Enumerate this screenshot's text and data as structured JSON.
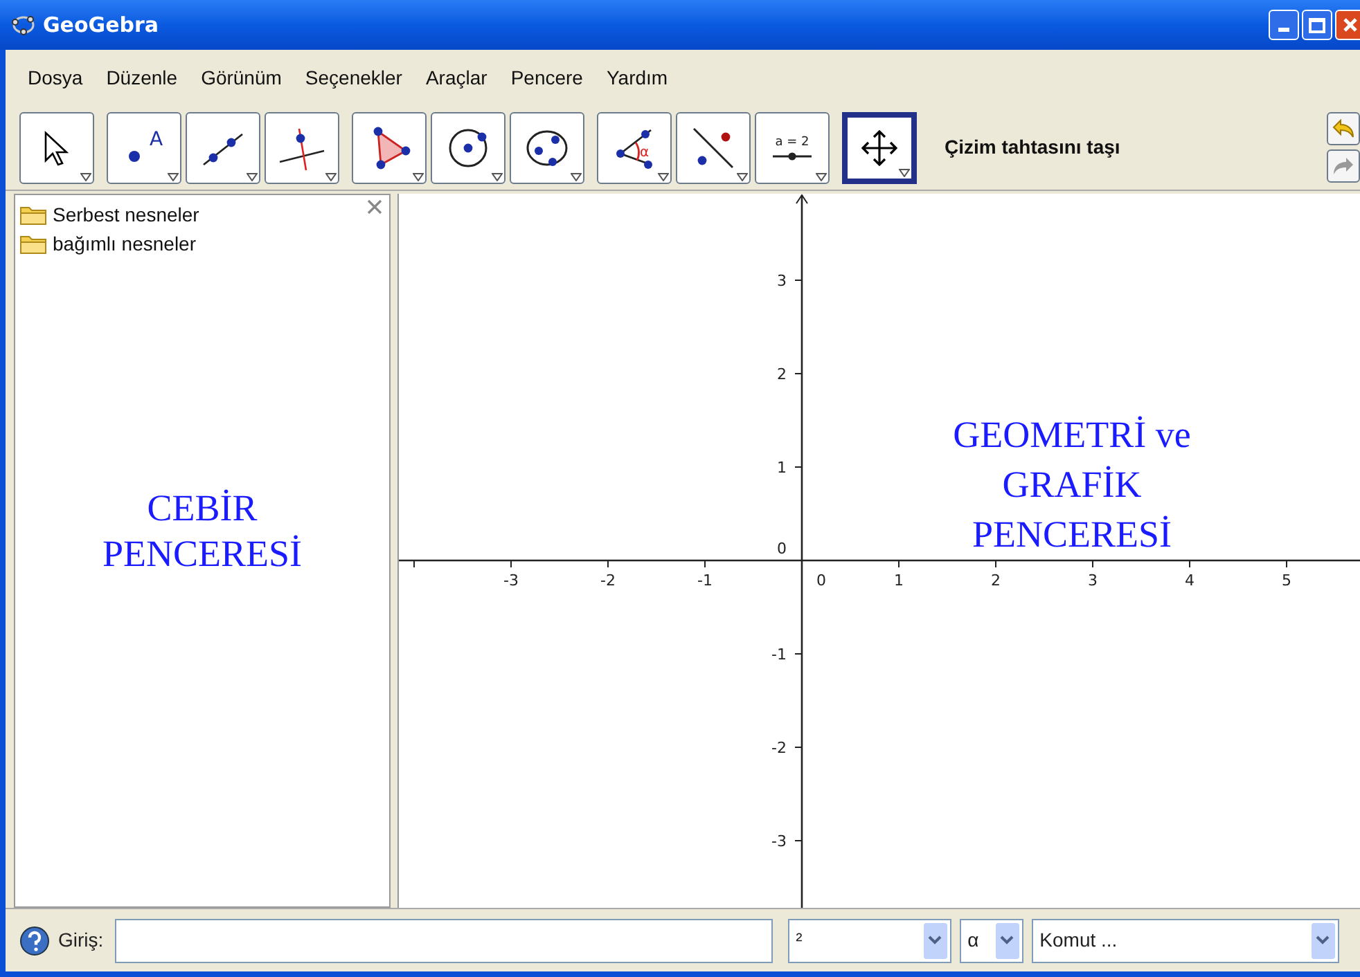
{
  "window": {
    "title": "GeoGebra"
  },
  "menu": [
    "Dosya",
    "Düzenle",
    "Görünüm",
    "Seçenekler",
    "Araçlar",
    "Pencere",
    "Yardım"
  ],
  "toolbar": [
    [
      {
        "kind": "move",
        "selected": false
      }
    ],
    [
      {
        "kind": "point",
        "selected": false,
        "label": "A"
      },
      {
        "kind": "line",
        "selected": false
      },
      {
        "kind": "perpendicular",
        "selected": false
      }
    ],
    [
      {
        "kind": "polygon",
        "selected": false
      },
      {
        "kind": "circle",
        "selected": false
      },
      {
        "kind": "conic",
        "selected": false
      }
    ],
    [
      {
        "kind": "angle",
        "selected": false,
        "label": "α"
      },
      {
        "kind": "reflect",
        "selected": false
      },
      {
        "kind": "slider",
        "selected": false,
        "label": "a = 2"
      }
    ],
    [
      {
        "kind": "move_view",
        "selected": true
      }
    ]
  ],
  "tool_name": "Çizim tahtasını taşı",
  "algebra": {
    "folders": [
      "Serbest nesneler",
      "bağımlı nesneler"
    ],
    "overlay": "CEBİR PENCERESİ"
  },
  "graphics": {
    "x_ticks": [
      "-3",
      "-2",
      "-1",
      "0",
      "1",
      "2",
      "3",
      "4",
      "5"
    ],
    "y_ticks": [
      "3",
      "2",
      "1",
      "0",
      "-1",
      "-2",
      "-3"
    ],
    "overlay": [
      "GEOMETRİ ve",
      "GRAFİK",
      "PENCERESİ"
    ]
  },
  "input_bar": {
    "label": "Giriş:",
    "dropdowns": [
      "²",
      "α",
      "Komut ..."
    ]
  }
}
